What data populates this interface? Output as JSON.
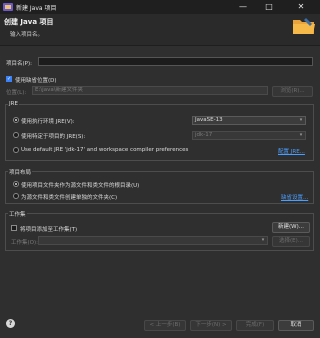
{
  "window": {
    "title": "新建 Java 项目",
    "minimize_glyph": "—",
    "maximize_glyph": "□",
    "close_glyph": "✕"
  },
  "header": {
    "title": "创建 Java 项目",
    "subtitle": "输入项目名。",
    "banner_icon": "java-project-folder-icon"
  },
  "project_name": {
    "label": "项目名(P):",
    "value": ""
  },
  "location": {
    "checkbox_label": "使用缺省位置(D)",
    "checked": true,
    "label": "位置(L):",
    "value": "E:\\java\\新建文件夹",
    "browse_label": "浏览(R)..."
  },
  "jre": {
    "group_title": "JRE",
    "option1_label": "使用执行环境 JRE(V):",
    "option1_value": "JavaSE-13",
    "option2_label": "使用特定于项目的 JRE(S):",
    "option2_value": "jdk-17",
    "option3_label": "Use default JRE 'jdk-17' and workspace compiler preferences",
    "configure_link": "配置 JRE..."
  },
  "layout": {
    "group_title": "项目布局",
    "option1_label": "使用项目文件夹作为源文件和类文件的根目录(U)",
    "option2_label": "为源文件和类文件创建单独的文件夹(C)",
    "configure_link": "缺省设置..."
  },
  "working_set": {
    "group_title": "工作集",
    "checkbox_label": "将项目添加至工作集(T)",
    "checked": false,
    "new_label": "新建(W)...",
    "label": "工作集(O):",
    "value": "",
    "select_label": "选择(E)..."
  },
  "footer": {
    "help_glyph": "?",
    "back_label": "< 上一步(B)",
    "next_label": "下一步(N) >",
    "finish_label": "完成(F)",
    "cancel_label": "取消"
  },
  "colors": {
    "background": "#2f2f2f",
    "checkbox_accent": "#3b82f6",
    "link": "#4a9eff"
  }
}
